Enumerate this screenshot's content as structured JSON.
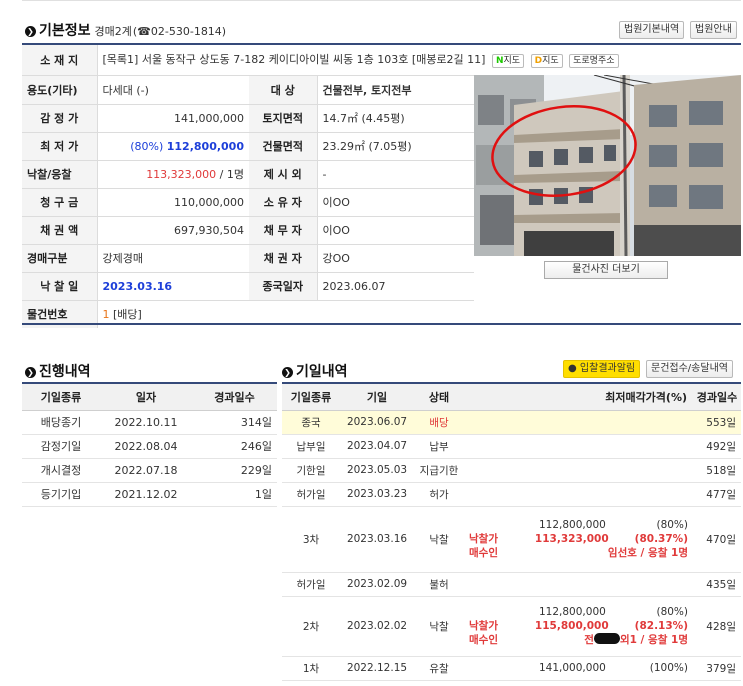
{
  "basic": {
    "title": "기본정보",
    "court": "경매2계",
    "phone": "(☎02-530-1814)",
    "btn_court_info": "법원기본내역",
    "btn_court_guide": "법원안내",
    "location_label": "소 재 지",
    "location_value": "[목록1] 서울 동작구 상도동 7-182 케이디아이빌 씨동 1층 103호 [매봉로2길 11]",
    "tag_naver": "지도",
    "tag_daum": "지도",
    "tag_road": "도로명주소",
    "rows": [
      {
        "l1": "용도(기타)",
        "v1": "다세대 (-)",
        "l2": "대 상",
        "v2": "건물전부, 토지전부"
      },
      {
        "l1": "감 정 가",
        "v1": "141,000,000",
        "l2": "토지면적",
        "v2": "14.7㎡ (4.45평)"
      },
      {
        "l1": "최 저 가",
        "v1a": "(80%)",
        "v1b": "112,800,000",
        "l2": "건물면적",
        "v2": "23.29㎡ (7.05평)"
      },
      {
        "l1": "낙찰/응찰",
        "v1a": "113,323,000",
        "v1b": " / 1명",
        "l2": "제 시 외",
        "v2": "-"
      },
      {
        "l1": "청 구 금",
        "v1": "110,000,000",
        "l2": "소 유 자",
        "v2": "이OO"
      },
      {
        "l1": "채 권 액",
        "v1": "697,930,504",
        "l2": "채 무 자",
        "v2": "이OO"
      },
      {
        "l1": "경매구분",
        "v1": "강제경매",
        "l2": "채 권 자",
        "v2": "강OO"
      },
      {
        "l1": "낙 찰 일",
        "v1": "2023.03.16",
        "l2": "종국일자",
        "v2": "2023.06.07"
      }
    ],
    "item_no_label": "물건번호",
    "item_no_num": "1",
    "item_no_text": " [배당]",
    "photo_more": "물건사진 더보기"
  },
  "progress": {
    "title": "진행내역",
    "headers": [
      "기일종류",
      "일자",
      "경과일수"
    ],
    "rows": [
      {
        "type": "배당종기",
        "date": "2022.10.11",
        "days": "314일"
      },
      {
        "type": "감정기일",
        "date": "2022.08.04",
        "days": "246일"
      },
      {
        "type": "개시결정",
        "date": "2022.07.18",
        "days": "229일"
      },
      {
        "type": "등기기입",
        "date": "2021.12.02",
        "days": "1일"
      }
    ]
  },
  "dates": {
    "title": "기일내역",
    "btn_result": "입찰결과알림",
    "btn_receipt": "문건접수/송달내역",
    "headers": [
      "기일종류",
      "기일",
      "상태",
      "최저매각가격(%)",
      "경과일수"
    ],
    "rows": [
      {
        "type": "종국",
        "date": "2023.06.07",
        "status": "배당",
        "days": "553일"
      },
      {
        "type": "납부일",
        "date": "2023.04.07",
        "status": "납부",
        "days": "492일"
      },
      {
        "type": "기한일",
        "date": "2023.05.03",
        "status": "지급기한",
        "days": "518일"
      },
      {
        "type": "허가일",
        "date": "2023.03.23",
        "status": "허가",
        "days": "477일"
      },
      {
        "type": "3차",
        "date": "2023.03.16",
        "status": "낙찰",
        "min": "112,800,000",
        "min_pct": "(80%)",
        "win_label": "낙찰가",
        "win_price": "113,323,000",
        "win_pct": "(80.37%)",
        "buyer_label": "매수인",
        "buyer": "임선호 / 응찰 1명",
        "days": "470일"
      },
      {
        "type": "허가일",
        "date": "2023.02.09",
        "status": "불허",
        "days": "435일"
      },
      {
        "type": "2차",
        "date": "2023.02.02",
        "status": "낙찰",
        "min": "112,800,000",
        "min_pct": "(80%)",
        "win_label": "낙찰가",
        "win_price": "115,800,000",
        "win_pct": "(82.13%)",
        "buyer_label": "매수인",
        "buyer_pre": "전",
        "buyer": "외1 / 응찰 1명",
        "days": "428일"
      },
      {
        "type": "1차",
        "date": "2022.12.15",
        "status": "유찰",
        "min": "141,000,000",
        "min_pct": "(100%)",
        "days": "379일"
      }
    ]
  }
}
